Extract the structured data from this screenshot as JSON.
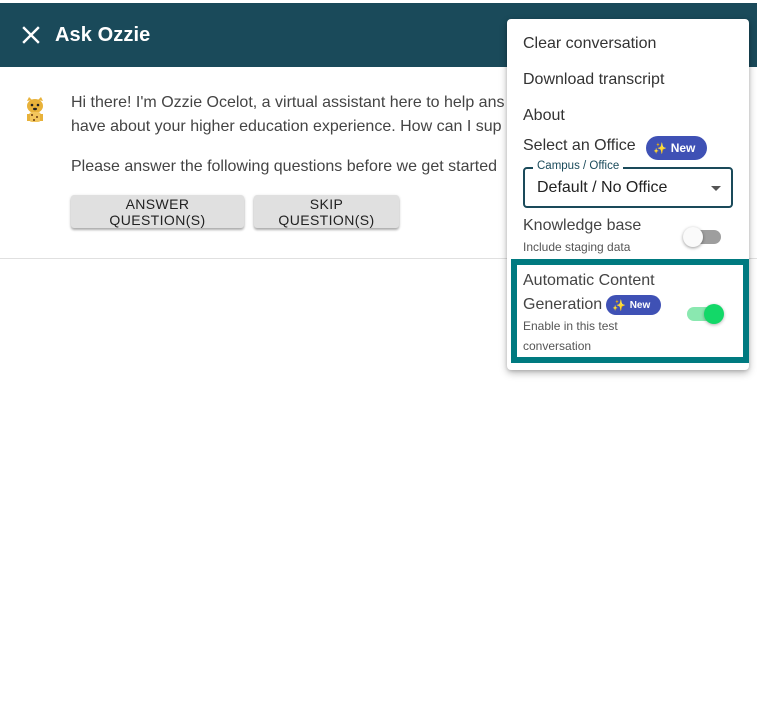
{
  "header": {
    "title": "Ask Ozzie",
    "bg_color": "#1a4a5a",
    "close_icon": "close-icon"
  },
  "chat": {
    "avatar_icon": "ocelot-avatar",
    "message_line1": "Hi there! I'm Ozzie Ocelot, a virtual assistant here to help ans",
    "message_line2": "have about your higher education experience. How can I sup",
    "prompt": "Please answer the following questions before we get started",
    "answer_button": "ANSWER QUESTION(S)",
    "skip_button": "SKIP QUESTION(S)"
  },
  "menu": {
    "clear": "Clear conversation",
    "download": "Download transcript",
    "about": "About",
    "office_label": "Select an Office",
    "new_badge": "New",
    "badge_icon": "sparkles-icon",
    "select_legend": "Campus / Office",
    "select_value": "Default / No Office",
    "kb_title": "Knowledge base",
    "kb_sub": "Include staging data",
    "kb_enabled": false,
    "acg_title1": "Automatic Content",
    "acg_title2": "Generation",
    "acg_sub1": "Enable in this test",
    "acg_sub2": "conversation",
    "acg_enabled": true,
    "highlight_color": "#007a80",
    "badge_color": "#3f51b5",
    "toggle_on_color": "#13d868"
  }
}
